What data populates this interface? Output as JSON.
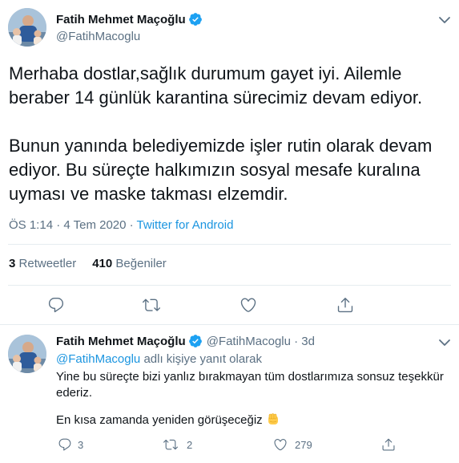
{
  "main_tweet": {
    "display_name": "Fatih Mehmet Maçoğlu",
    "handle": "@FatihMacoglu",
    "text": "Merhaba dostlar,sağlık durumum gayet iyi. Ailemle beraber 14 günlük karantina sürecimiz devam ediyor.\n\nBunun yanında belediyemizde işler rutin olarak  devam ediyor.  Bu süreçte halkımızın sosyal mesafe kuralına uyması ve maske takması elzemdir.",
    "time": "ÖS 1:14 · 4 Tem 2020 · ",
    "source": "Twitter for Android",
    "retweets_count": "3",
    "retweets_label": "Retweetler",
    "likes_count": "410",
    "likes_label": "Beğeniler"
  },
  "reply_tweet": {
    "display_name": "Fatih Mehmet Maçoğlu",
    "handle_time": "@FatihMacoglu · 3d",
    "reply_mention": "@FatihMacoglu",
    "reply_suffix": " adlı kişiye yanıt olarak",
    "text_line1": "Yine bu süreçte bizi yanlız bırakmayan tüm dostlarımıza sonsuz teşekkür ederiz.",
    "text_line2": "En kısa zamanda yeniden görüşeceğiz",
    "reply_count": "3",
    "retweet_count": "2",
    "like_count": "279"
  },
  "icons": {
    "verified": "verified-badge-icon",
    "reply": "reply-icon",
    "retweet": "retweet-icon",
    "like": "heart-icon",
    "share": "share-icon",
    "more": "chevron-down-icon",
    "emoji": "fist-emoji-icon"
  },
  "colors": {
    "brand_blue": "#1da1f2",
    "link_blue": "#1b95e0",
    "muted_text": "#5b7083",
    "divider": "#e6ecf0"
  }
}
